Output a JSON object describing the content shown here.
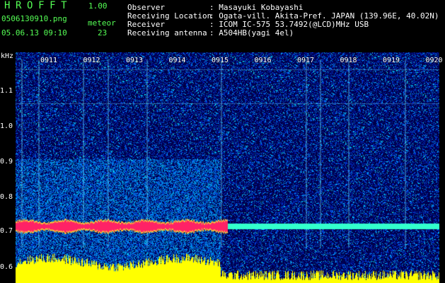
{
  "header": {
    "app_name": "HROFFT",
    "version": "1.00",
    "filename": "0506130910.png",
    "datetime": "05.06.13 09:10",
    "meteor_label": "meteor",
    "meteor_count": "23",
    "fields": [
      {
        "label": "Observer",
        "value": ": Masayuki Kobayashi"
      },
      {
        "label": "Receiving Location",
        "value": ": Ogata-vill. Akita-Pref. JAPAN (139.96E, 40.02N)"
      },
      {
        "label": "Receiver",
        "value": ": ICOM IC-575 53.7492(@LCD)MHz USB"
      },
      {
        "label": "Receiving antenna",
        "value": ": A504HB(yagi 4el)"
      }
    ]
  },
  "spectrogram": {
    "y_unit": "kHz",
    "y_ticks": [
      "1.1",
      "1.0",
      "0.9",
      "0.8",
      "0.7",
      "0.6"
    ],
    "x_ticks": [
      "0911",
      "0912",
      "0913",
      "0914",
      "0915",
      "0916",
      "0917",
      "0918",
      "0919",
      "0920"
    ],
    "colors": {
      "background": "#000066",
      "noise": "#0044ff",
      "signal": "#ff2266",
      "histogram": "#ffff00",
      "carrier": "#33ffcc"
    }
  }
}
